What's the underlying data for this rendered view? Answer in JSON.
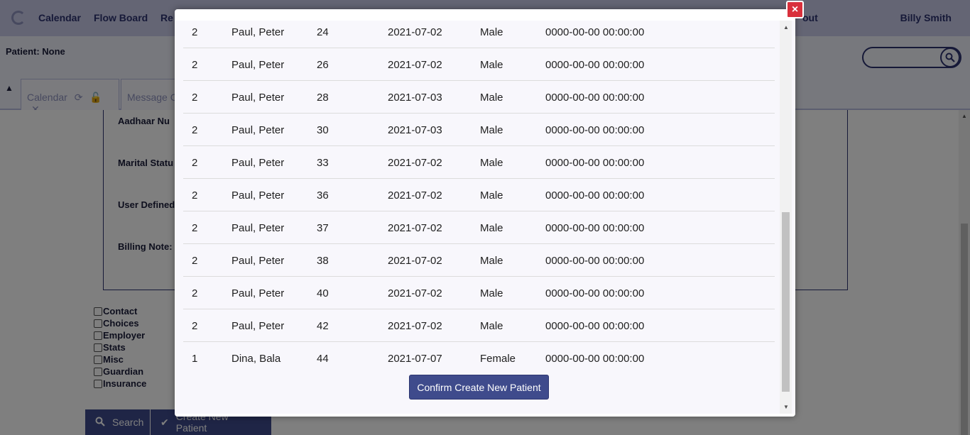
{
  "navbar": {
    "items": [
      "Calendar",
      "Flow Board",
      "Re",
      "out"
    ],
    "user": "Billy Smith"
  },
  "patient_bar": {
    "label": "Patient: None",
    "search_placeholder": ""
  },
  "tabs": [
    {
      "label": "Calendar"
    },
    {
      "label": "Message C"
    }
  ],
  "form": {
    "labels": [
      "Aadhaar Nu",
      "Marital Statu",
      "User Defined",
      "Billing Note:"
    ],
    "checkboxes": [
      "Contact",
      "Choices",
      "Employer",
      "Stats",
      "Misc",
      "Guardian",
      "Insurance"
    ],
    "search_button": "Search",
    "create_button": "Create New Patient"
  },
  "modal": {
    "rows": [
      {
        "pid": "2",
        "name": "Paul, Peter",
        "id": "24",
        "dob": "2021-07-02",
        "sex": "Male",
        "date": "0000-00-00 00:00:00"
      },
      {
        "pid": "2",
        "name": "Paul, Peter",
        "id": "26",
        "dob": "2021-07-02",
        "sex": "Male",
        "date": "0000-00-00 00:00:00"
      },
      {
        "pid": "2",
        "name": "Paul, Peter",
        "id": "28",
        "dob": "2021-07-03",
        "sex": "Male",
        "date": "0000-00-00 00:00:00"
      },
      {
        "pid": "2",
        "name": "Paul, Peter",
        "id": "30",
        "dob": "2021-07-03",
        "sex": "Male",
        "date": "0000-00-00 00:00:00"
      },
      {
        "pid": "2",
        "name": "Paul, Peter",
        "id": "33",
        "dob": "2021-07-02",
        "sex": "Male",
        "date": "0000-00-00 00:00:00"
      },
      {
        "pid": "2",
        "name": "Paul, Peter",
        "id": "36",
        "dob": "2021-07-02",
        "sex": "Male",
        "date": "0000-00-00 00:00:00"
      },
      {
        "pid": "2",
        "name": "Paul, Peter",
        "id": "37",
        "dob": "2021-07-02",
        "sex": "Male",
        "date": "0000-00-00 00:00:00"
      },
      {
        "pid": "2",
        "name": "Paul, Peter",
        "id": "38",
        "dob": "2021-07-02",
        "sex": "Male",
        "date": "0000-00-00 00:00:00"
      },
      {
        "pid": "2",
        "name": "Paul, Peter",
        "id": "40",
        "dob": "2021-07-02",
        "sex": "Male",
        "date": "0000-00-00 00:00:00"
      },
      {
        "pid": "2",
        "name": "Paul, Peter",
        "id": "42",
        "dob": "2021-07-02",
        "sex": "Male",
        "date": "0000-00-00 00:00:00"
      },
      {
        "pid": "1",
        "name": "Dina, Bala",
        "id": "44",
        "dob": "2021-07-07",
        "sex": "Female",
        "date": "0000-00-00 00:00:00"
      }
    ],
    "confirm_button": "Confirm Create New Patient",
    "close_icon": "×"
  },
  "colors": {
    "primary": "#3f4b8c",
    "navbar": "#c8cbe8",
    "close": "#d9303c"
  }
}
